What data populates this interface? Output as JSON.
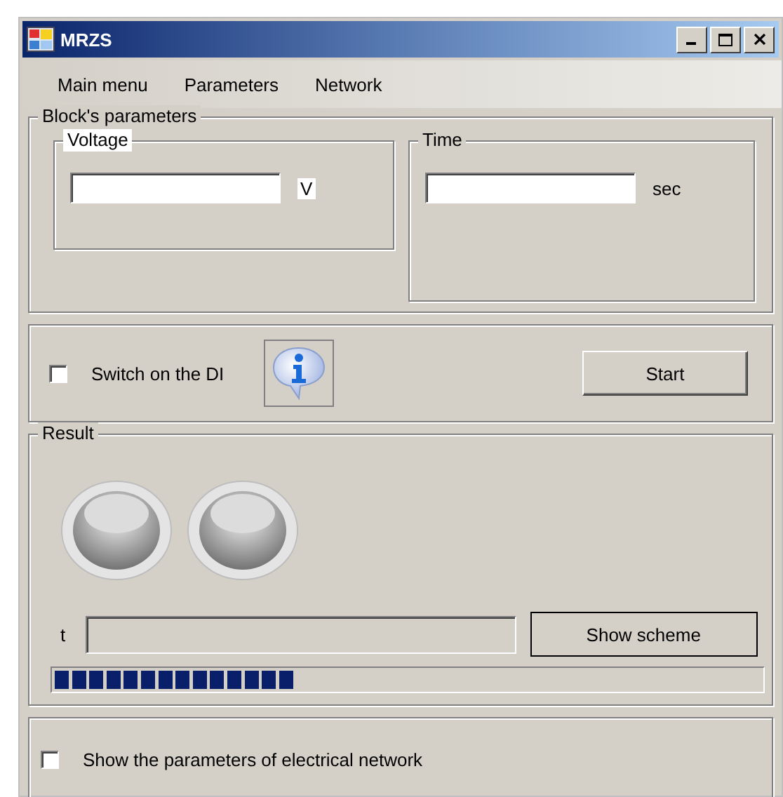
{
  "window": {
    "title": "MRZS"
  },
  "menu": [
    {
      "label": "Main menu"
    },
    {
      "label": "Parameters"
    },
    {
      "label": "Network"
    }
  ],
  "block_parameters": {
    "title": "Block's parameters",
    "voltage": {
      "title": "Voltage",
      "unit": "V"
    },
    "time": {
      "title": "Time",
      "unit": "sec"
    }
  },
  "di": {
    "label": "Switch on the DI",
    "checked": false
  },
  "start_button": "Start",
  "result": {
    "title": "Result",
    "indicators": [
      {
        "on": false
      },
      {
        "on": false
      }
    ],
    "t_label": "t",
    "show_scheme_button": "Show scheme",
    "progress": {
      "level": 0.34
    }
  },
  "network_toggle": {
    "label": "Show the parameters of electrical network",
    "checked": false
  }
}
